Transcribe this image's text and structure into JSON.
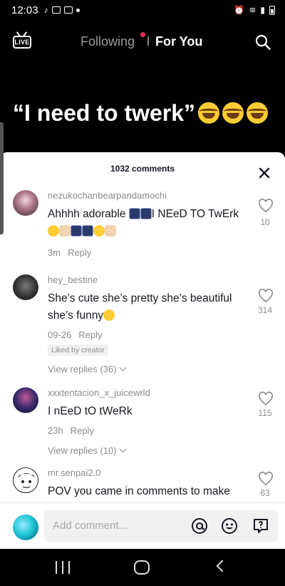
{
  "status_bar": {
    "time": "12:03"
  },
  "top_nav": {
    "live_label": "LIVE",
    "following_label": "Following",
    "for_you_label": "For You"
  },
  "video": {
    "caption": "“I need to twerk”"
  },
  "comments_panel": {
    "count_label": "1032 comments",
    "comments": [
      {
        "username": "nezukochanbearpandamochi",
        "text_part1": "Ahhhh adorable ",
        "text_part2": "I NEeD TO TwErk",
        "time": "3m",
        "reply_label": "Reply",
        "likes": "10"
      },
      {
        "username": "hey_bestine",
        "text": "She’s cute she’s pretty she’s beautiful she’s funny",
        "time": "09-26",
        "reply_label": "Reply",
        "likes": "314",
        "badge": "Liked by creator",
        "view_replies": "View replies (36)"
      },
      {
        "username": "xxxtentacion_x_juicewrld",
        "text": "I nEeD tO tWeRk",
        "time": "23h",
        "reply_label": "Reply",
        "likes": "115",
        "view_replies": "View replies (10)"
      },
      {
        "username": "mr.senpai2.0",
        "text": "POV you came in comments to make",
        "likes": "63"
      }
    ]
  },
  "comment_input": {
    "placeholder": "Add comment..."
  },
  "colors": {
    "accent": "#fe2c55",
    "secondary_text": "#8a8b91",
    "sheet_bg": "#ffffff"
  },
  "icons": [
    "live-icon",
    "search-icon",
    "close-icon",
    "heart-icon",
    "at-icon",
    "emoji-icon",
    "gift-icon"
  ]
}
